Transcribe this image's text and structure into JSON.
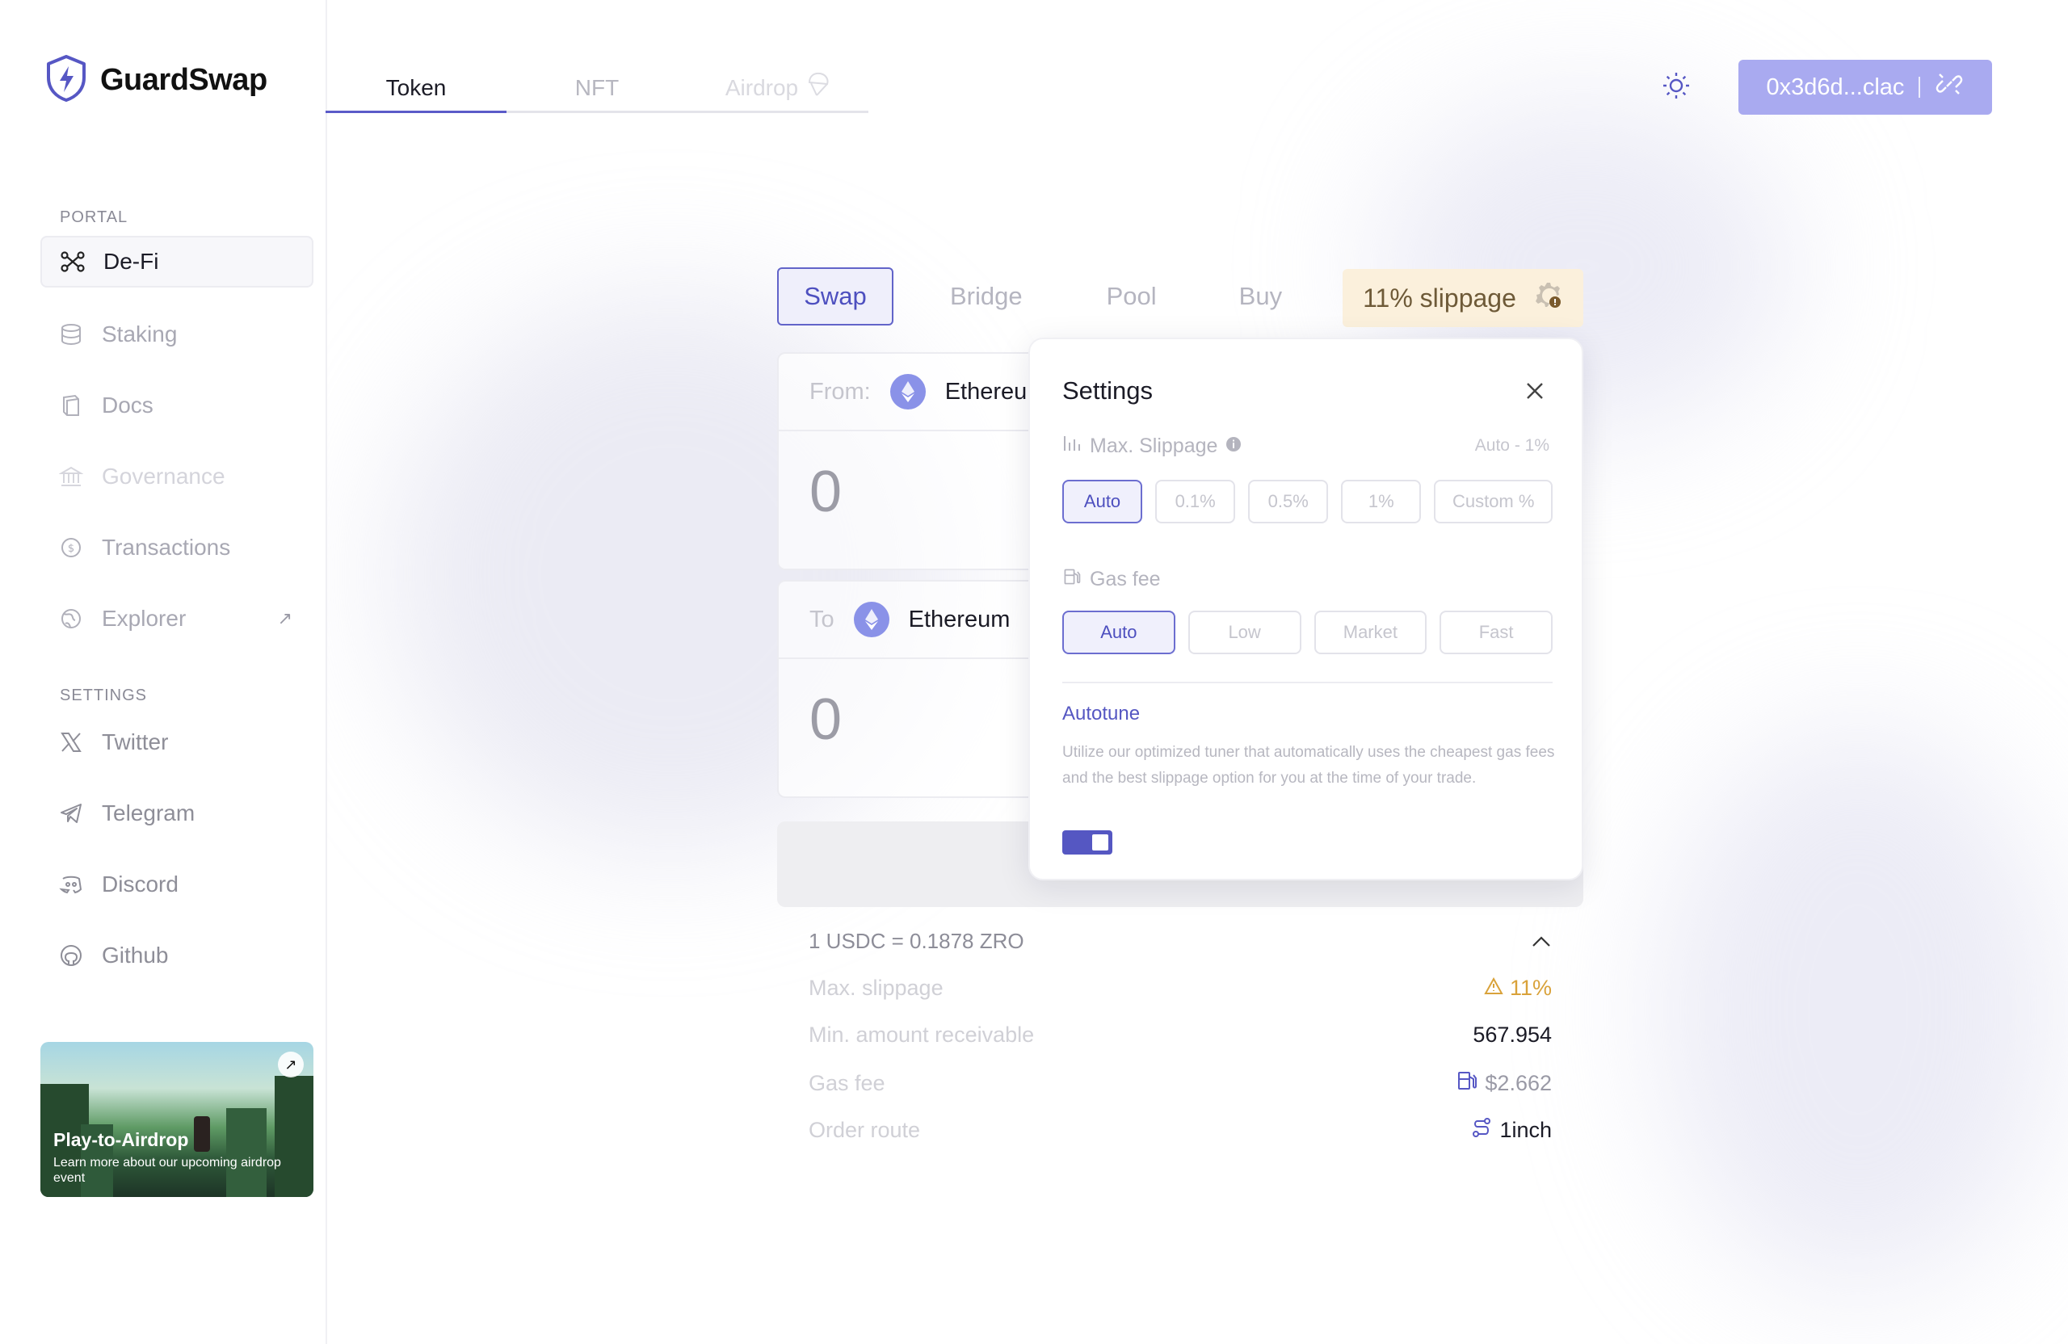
{
  "app": {
    "name": "GuardSwap"
  },
  "colors": {
    "accent": "#5b5bc8",
    "wallet": "#a9aaf0",
    "warning": "#d9a23a",
    "badge_bg": "#fbf0dc"
  },
  "top_tabs": [
    {
      "label": "Token",
      "active": true
    },
    {
      "label": "NFT",
      "active": false
    },
    {
      "label": "Airdrop",
      "active": false
    }
  ],
  "wallet": {
    "address": "0x3d6d...clac"
  },
  "sidebar": {
    "portal_label": "PORTAL",
    "settings_label": "SETTINGS",
    "portal_items": [
      {
        "label": "De-Fi",
        "icon": "network-icon",
        "state": "active"
      },
      {
        "label": "Staking",
        "icon": "database-icon",
        "state": "normal"
      },
      {
        "label": "Docs",
        "icon": "book-icon",
        "state": "normal"
      },
      {
        "label": "Governance",
        "icon": "bank-icon",
        "state": "disabled"
      },
      {
        "label": "Transactions",
        "icon": "coin-icon",
        "state": "normal"
      },
      {
        "label": "Explorer",
        "icon": "globe-icon",
        "state": "normal",
        "external": true
      }
    ],
    "settings_items": [
      {
        "label": "Twitter",
        "icon": "x-logo-icon"
      },
      {
        "label": "Telegram",
        "icon": "telegram-icon"
      },
      {
        "label": "Discord",
        "icon": "discord-icon"
      },
      {
        "label": "Github",
        "icon": "github-icon"
      }
    ],
    "promo": {
      "title": "Play-to-Airdrop",
      "subtitle": "Learn more about our upcoming airdrop event"
    }
  },
  "swap": {
    "subtabs": [
      "Swap",
      "Bridge",
      "Pool",
      "Buy"
    ],
    "slippage_badge": "11% slippage",
    "from": {
      "label": "From:",
      "token": "Ethereum",
      "amount": "0"
    },
    "to": {
      "label": "To",
      "token": "Ethereum",
      "amount": "0"
    },
    "rate": "1 USDC = 0.1878 ZRO",
    "details": [
      {
        "key": "Max. slippage",
        "value": "11%",
        "icon": "warning-icon"
      },
      {
        "key": "Min. amount receivable",
        "value": "567.954"
      },
      {
        "key": "Gas fee",
        "value": "$2.662",
        "icon": "fuel-icon"
      },
      {
        "key": "Order route",
        "value": "1inch",
        "icon": "route-icon"
      }
    ]
  },
  "settings": {
    "title": "Settings",
    "max_slippage_label": "Max. Slippage",
    "max_slippage_note": "Auto - 1%",
    "slippage_options": [
      "Auto",
      "0.1%",
      "0.5%",
      "1%",
      "Custom %"
    ],
    "slippage_selected": "Auto",
    "gas_label": "Gas fee",
    "gas_options": [
      "Auto",
      "Low",
      "Market",
      "Fast"
    ],
    "gas_selected": "Auto",
    "autotune_title": "Autotune",
    "autotune_desc": "Utilize our optimized tuner that automatically uses the cheapest gas fees and the best slippage option for you at the time of your trade.",
    "autotune_on": true
  }
}
